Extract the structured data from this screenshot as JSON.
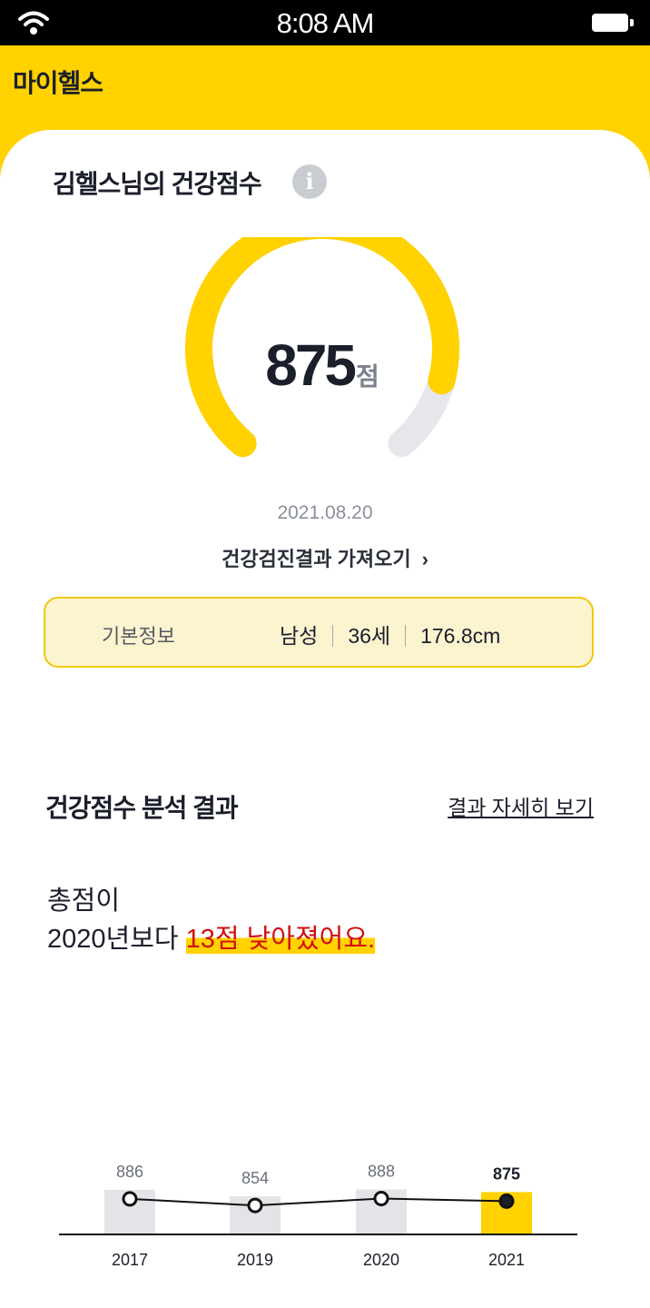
{
  "status": {
    "time": "8:08 AM"
  },
  "header": {
    "title": "마이헬스"
  },
  "score_card": {
    "title": "김헬스님의 건강점수",
    "info_icon": "i",
    "score": "875",
    "score_unit": "점",
    "score_fraction": 0.875,
    "date": "2021.08.20",
    "import_label": "건강검진결과 가져오기",
    "import_chevron": "›"
  },
  "basic_info": {
    "label": "기본정보",
    "gender": "남성",
    "age": "36세",
    "height": "176.8cm"
  },
  "analysis": {
    "title": "건강점수 분석 결과",
    "detail_link": "결과 자세히 보기",
    "summary_line1": "총점이",
    "summary_line2_prefix": "2020년보다 ",
    "summary_highlight": "13점 낮아졌어요."
  },
  "colors": {
    "brand_yellow": "#ffd200",
    "track_gray": "#e6e7ea",
    "bar_gray": "#e3e4e8",
    "highlight_red": "#d10f0f"
  },
  "chart_data": {
    "type": "bar",
    "categories": [
      "2017",
      "2019",
      "2020",
      "2021"
    ],
    "values": [
      886,
      854,
      888,
      875
    ],
    "value_labels": [
      "886",
      "854",
      "888",
      "875"
    ],
    "highlight_index": 3,
    "title": "",
    "xlabel": "",
    "ylabel": ""
  }
}
